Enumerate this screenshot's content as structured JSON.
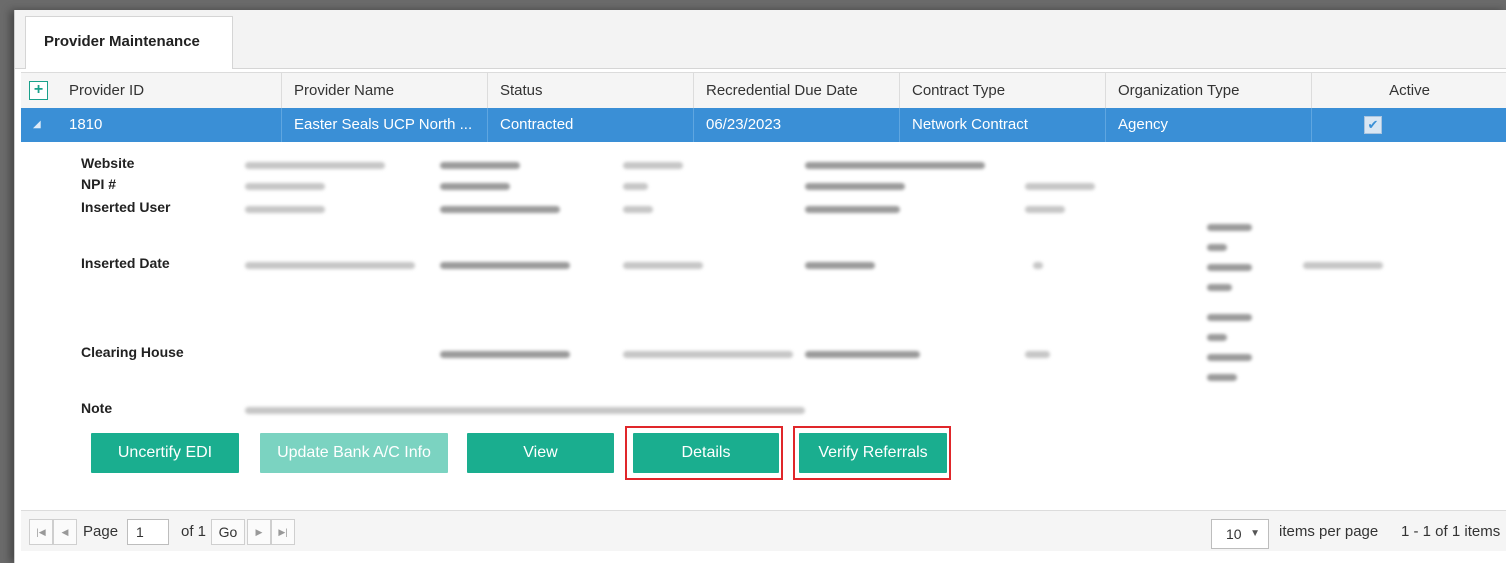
{
  "tab": {
    "label": "Provider Maintenance"
  },
  "grid": {
    "add_symbol": "+",
    "columns": [
      "Provider ID",
      "Provider Name",
      "Status",
      "Recredential Due Date",
      "Contract Type",
      "Organization Type",
      "Active"
    ],
    "row": {
      "expander": "◢",
      "provider_id": "1810",
      "provider_name": "Easter Seals UCP North ...",
      "status": "Contracted",
      "recredential_due_date": "06/23/2023",
      "contract_type": "Network Contract",
      "organization_type": "Agency",
      "active_check": "✔"
    }
  },
  "details": {
    "labels": {
      "website": "Website",
      "npi": "NPI #",
      "inserted_user": "Inserted User",
      "inserted_date": "Inserted Date",
      "clearing_house": "Clearing House",
      "note": "Note"
    }
  },
  "actions": {
    "uncertify": "Uncertify EDI",
    "update_bank": "Update Bank A/C Info",
    "view": "View",
    "details": "Details",
    "verify_referrals": "Verify Referrals"
  },
  "pager": {
    "first_icon": "first-page-icon",
    "prev_icon": "previous-page-icon",
    "next_icon": "next-page-icon",
    "last_icon": "last-page-icon",
    "page_label": "Page",
    "page_value": "1",
    "of_label": "of 1",
    "go_label": "Go",
    "page_size": "10",
    "items_per_page_label": "items per page",
    "summary": "1 - 1 of 1 items"
  },
  "colors": {
    "accent": "#1aae8f",
    "selected_row": "#3a8fd6",
    "highlight": "#e0262a"
  }
}
